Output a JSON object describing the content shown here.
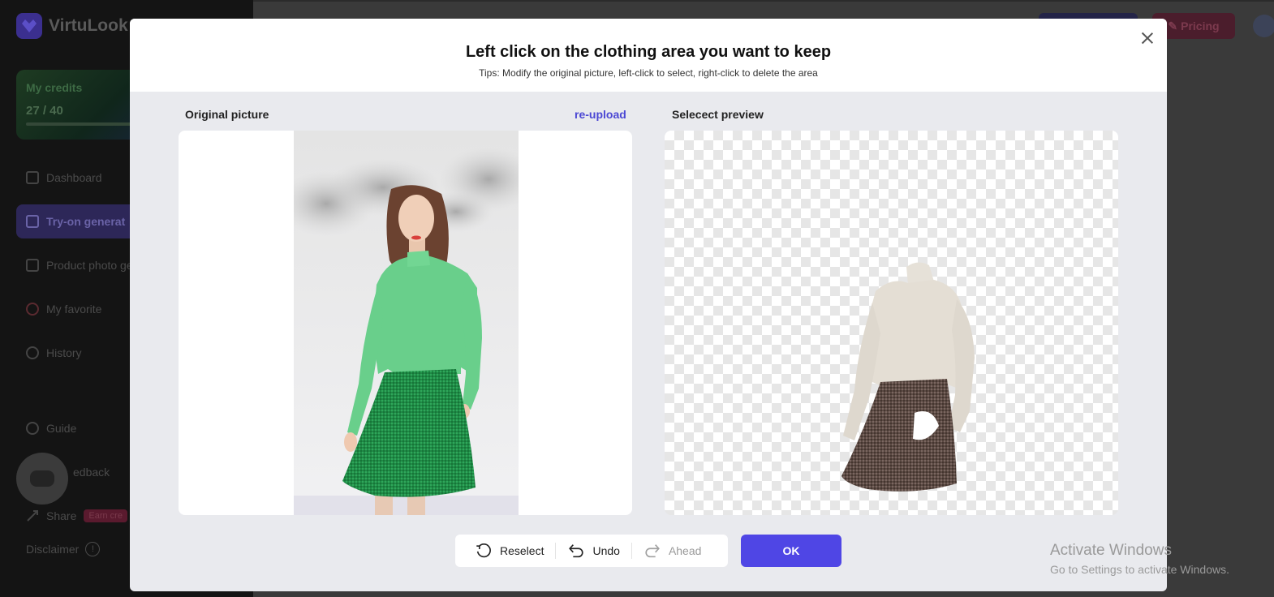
{
  "background": {
    "app_name": "VirtuLook",
    "credits": {
      "title": "My credits",
      "value": "27 / 40"
    },
    "nav": [
      {
        "label": "Dashboard"
      },
      {
        "label": "Try-on generat"
      },
      {
        "label": "Product photo ge"
      },
      {
        "label": "My favorite"
      },
      {
        "label": "History"
      },
      {
        "label": "Guide"
      },
      {
        "label": "edback"
      },
      {
        "label": "Share"
      }
    ],
    "share_badge": "Earn cre",
    "disclaimer": "Disclaimer",
    "pricing_label": "Pricing"
  },
  "modal": {
    "title": "Left click on the clothing area you want to keep",
    "tips": "Tips: Modify the original picture, left-click to select, right-click to delete the area",
    "left_label": "Original picture",
    "reupload": "re-upload",
    "right_label": "Selecect preview",
    "toolbar": {
      "reselect": "Reselect",
      "undo": "Undo",
      "ahead": "Ahead"
    },
    "ok": "OK"
  },
  "watermark": {
    "title": "Activate Windows",
    "subtitle": "Go to Settings to activate Windows."
  }
}
